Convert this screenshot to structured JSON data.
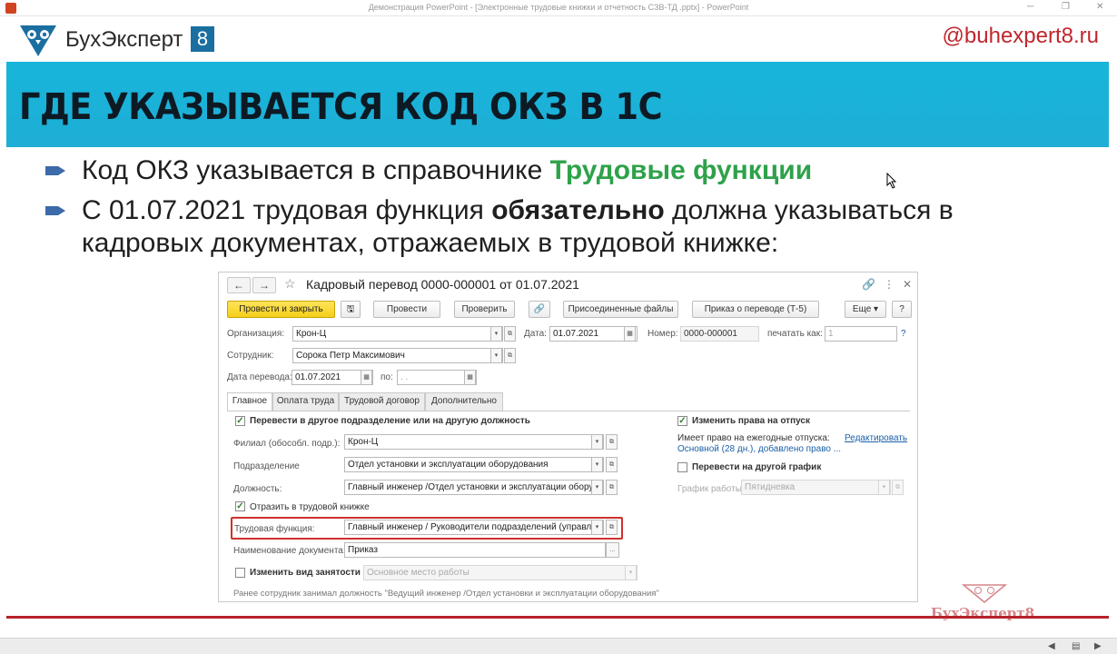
{
  "window": {
    "title": "Демонстрация PowerPoint - [Электронные трудовые книжки и отчетность СЗВ-ТД .pptx] - PowerPoint"
  },
  "header": {
    "brand_name": "БухЭксперт",
    "brand_number": "8",
    "site": "@buhexpert8.ru"
  },
  "slide": {
    "title": "ГДЕ УКАЗЫВАЕТСЯ КОД ОКЗ В 1С",
    "bullet1": {
      "text": "Код ОКЗ указывается в справочнике",
      "highlight": "Трудовые функции"
    },
    "bullet2": {
      "pre": "С 01.07.2021 трудовая функция",
      "bold": "обязательно",
      "post": "должна указываться в кадровых документах, отражаемых в трудовой книжке:"
    }
  },
  "form": {
    "nav_back": "←",
    "nav_forward": "→",
    "star": "☆",
    "title": "Кадровый перевод 0000-000001 от 01.07.2021",
    "toolbar": {
      "post_close": "Провести и закрыть",
      "save": "🖫",
      "post": "Провести",
      "check": "Проверить",
      "attach": "🔗",
      "attached_files": "Присоединенные файлы",
      "print_order": "Приказ о переводе (Т-5)",
      "more": "Еще ▾",
      "help": "?"
    },
    "org_label": "Организация:",
    "org_value": "Крон-Ц",
    "date_label": "Дата:",
    "date_value": "01.07.2021",
    "number_label": "Номер:",
    "number_value": "0000-000001",
    "print_as_label": "печатать как:",
    "print_as_value": "1",
    "employee_label": "Сотрудник:",
    "employee_value": "Сорока Петр Максимович",
    "transfer_date_label": "Дата перевода:",
    "transfer_date_value": "01.07.2021",
    "to_label": "по:",
    "to_value": ". .",
    "tabs": [
      "Главное",
      "Оплата труда",
      "Трудовой договор",
      "Дополнительно"
    ],
    "transfer_chk": "Перевести в другое подразделение или на другую должность",
    "branch_label": "Филиал (обособл. подр.):",
    "branch_value": "Крон-Ц",
    "dept_label": "Подразделение",
    "dept_value": "Отдел установки и эксплуатации оборудования",
    "position_label": "Должность:",
    "position_value": "Главный инженер /Отдел установки и эксплуатации оборудо",
    "workbook_chk": "Отразить в трудовой книжке",
    "labor_func_label": "Трудовая функция:",
    "labor_func_value": "Главный инженер / Руководители подразделений (управляю",
    "doc_name_label": "Наименование документа:",
    "doc_name_value": "Приказ",
    "doc_name_btn": "...",
    "employment_chk": "Изменить вид занятости",
    "employment_value": "Основное место работы",
    "vacation_chk": "Изменить права на отпуск",
    "vacation_text1": "Имеет право на ежегодные отпуска:",
    "vacation_text2": "Основной (28 дн.), добавлено право ...",
    "edit_link": "Редактировать",
    "schedule_chk": "Перевести на другой график",
    "schedule_label": "График работы:",
    "schedule_value": "Пятидневка",
    "note": "Ранее сотрудник занимал должность \"Ведущий инженер /Отдел установки и эксплуатации оборудования\""
  },
  "watermark": "БухЭксперт8",
  "colors": {
    "band": "#1fb0d8",
    "brand_red": "#c0262d",
    "green": "#2ea24a",
    "primary_button": "#f5cf18",
    "highlight_box": "#d0312d"
  }
}
